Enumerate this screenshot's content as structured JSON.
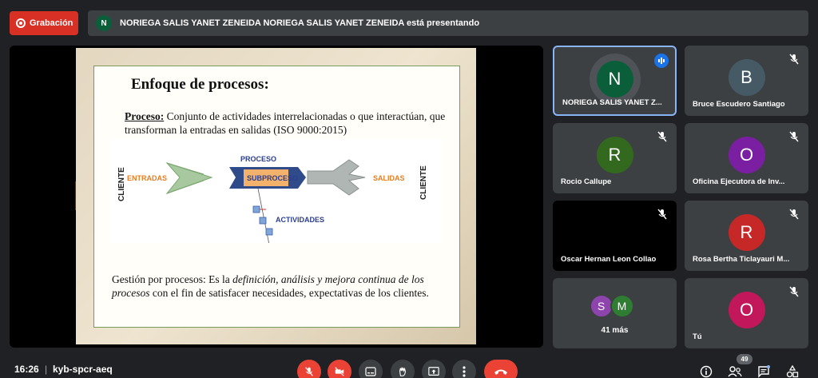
{
  "topbar": {
    "record_label": "Grabación",
    "presenter_initial": "N",
    "presenting_text": "NORIEGA SALIS YANET ZENEIDA NORIEGA SALIS YANET ZENEIDA está presentando"
  },
  "slide": {
    "title": "Enfoque de procesos:",
    "def_term": "Proceso:",
    "def_text": " Conjunto de actividades interrelacionadas o que interactúan, que transforman la entradas en salidas (ISO 9000:2015)",
    "diagram": {
      "client_left": "CLIENTE",
      "client_right": "CLIENTE",
      "inputs": "ENTRADAS",
      "process": "PROCESO",
      "subprocess": "SUBPROCESO",
      "activities": "ACTIVIDADES",
      "outputs": "SALIDAS"
    },
    "foot_1": "Gestión por procesos: Es la ",
    "foot_em1": "definición, análisis y mejora continua de los procesos",
    "foot_2": " con el fin de satisfacer necesidades, expectativas de los clientes."
  },
  "participants": [
    {
      "initial": "N",
      "name": "NORIEGA SALIS YANET Z...",
      "color": "#0b5e3a",
      "speaking": true
    },
    {
      "initial": "B",
      "name": "Bruce Escudero Santiago",
      "color": "#455a64"
    },
    {
      "initial": "R",
      "name": "Rocio Callupe",
      "color": "#33691e"
    },
    {
      "initial": "O",
      "name": "Oficina Ejecutora de Inv...",
      "color": "#7b1fa2"
    },
    {
      "name": "Oscar Hernan Leon Collao"
    },
    {
      "initial": "R",
      "name": "Rosa Bertha Ticlayauri M...",
      "color": "#c62828"
    },
    {
      "initials": [
        "S",
        "M"
      ],
      "colors": [
        "#8e44ad",
        "#2e7d32"
      ],
      "more_label": "41 más"
    },
    {
      "initial": "O",
      "name": "Tú",
      "color": "#c2185b"
    }
  ],
  "bottom": {
    "time": "16:26",
    "separator": "|",
    "meeting_code": "kyb-spcr-aeq",
    "people_count": "49"
  },
  "colors": {
    "accent": "#8ab4f8",
    "danger": "#ea4335",
    "surface": "#3c4043",
    "background": "#202124"
  }
}
